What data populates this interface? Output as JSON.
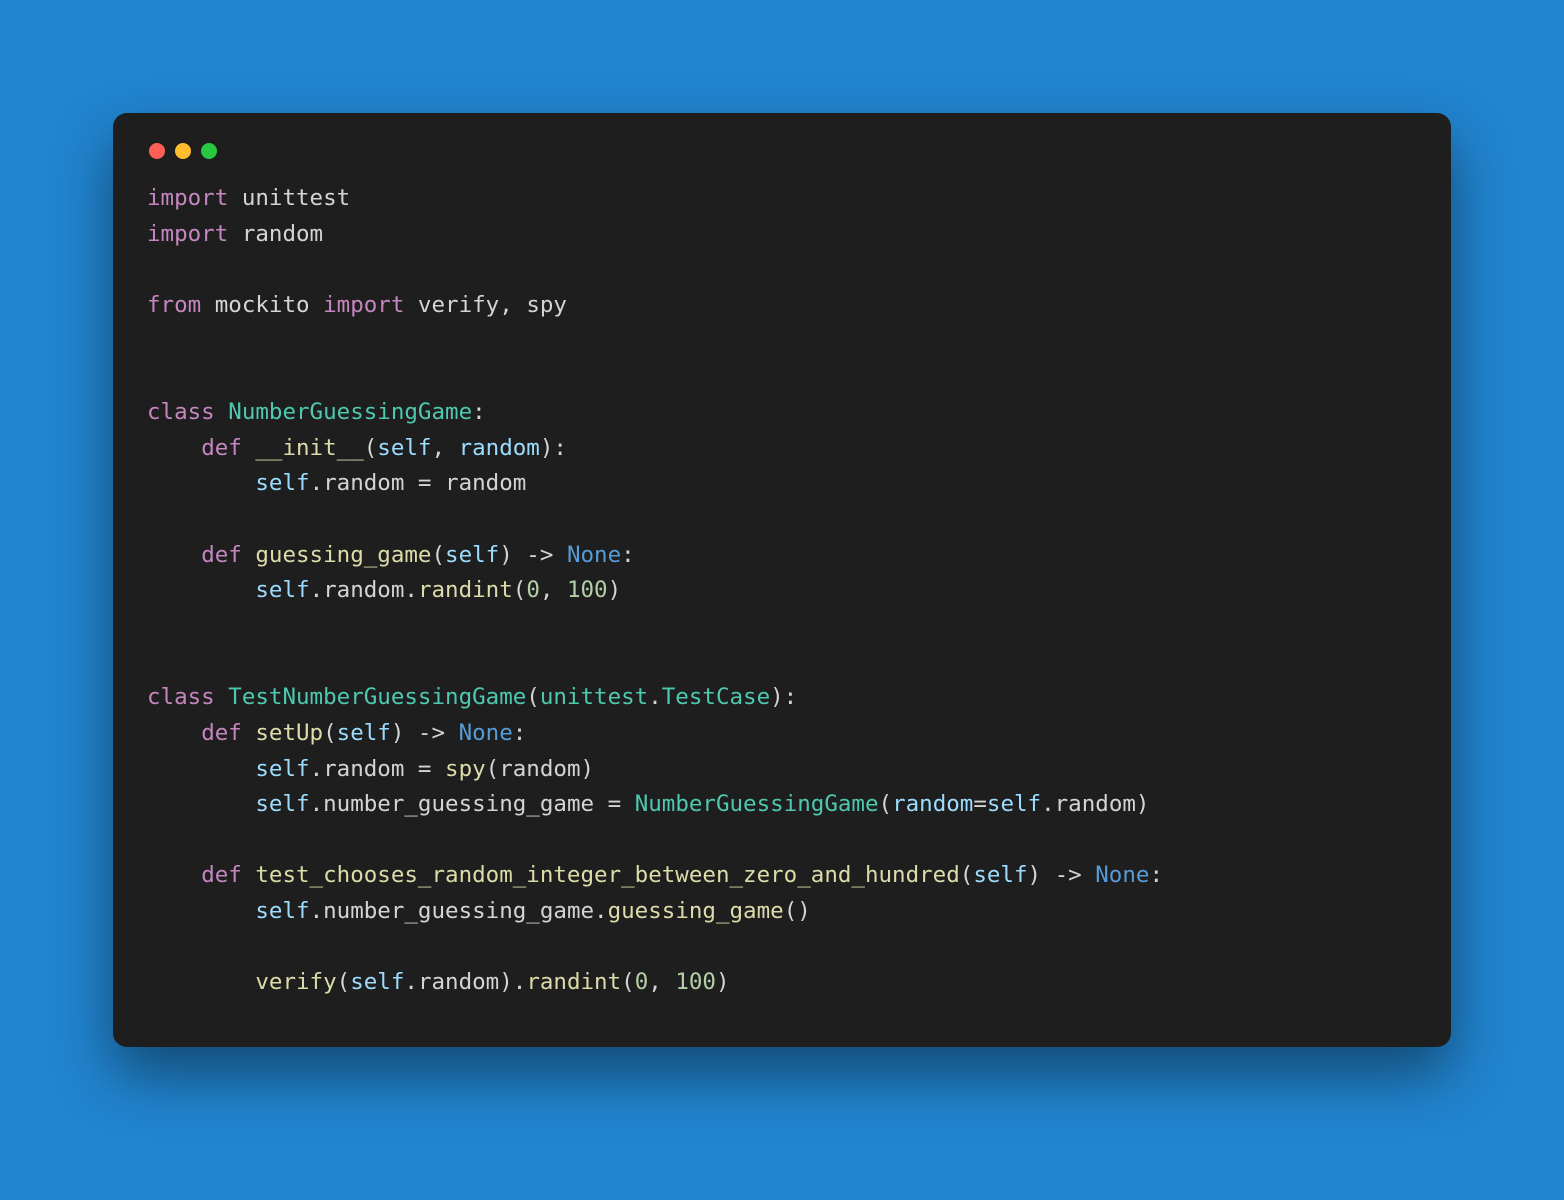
{
  "window": {
    "traffic_colors": {
      "red": "#ff5f57",
      "yellow": "#febc2e",
      "green": "#28c840"
    }
  },
  "theme": {
    "page_bg": "#2185d0",
    "editor_bg": "#1e1e1e",
    "fg": "#d4d4d4",
    "keyword": "#c586c0",
    "classname": "#4ec9b0",
    "function": "#dcdcaa",
    "selfparam": "#9cdcfe",
    "number": "#b5cea8",
    "builtin_const": "#569cd6"
  },
  "code": {
    "language": "python",
    "tokens": [
      [
        [
          "kw",
          "import"
        ],
        [
          "id",
          " unittest"
        ]
      ],
      [
        [
          "kw",
          "import"
        ],
        [
          "id",
          " random"
        ]
      ],
      [],
      [
        [
          "kw",
          "from"
        ],
        [
          "id",
          " mockito "
        ],
        [
          "kw",
          "import"
        ],
        [
          "id",
          " verify"
        ],
        [
          "pun",
          ", "
        ],
        [
          "id",
          "spy"
        ]
      ],
      [],
      [],
      [
        [
          "kw",
          "class"
        ],
        [
          "id",
          " "
        ],
        [
          "cls",
          "NumberGuessingGame"
        ],
        [
          "pun",
          ":"
        ]
      ],
      [
        [
          "id",
          "    "
        ],
        [
          "kw",
          "def"
        ],
        [
          "id",
          " "
        ],
        [
          "fn",
          "__init__"
        ],
        [
          "pun",
          "("
        ],
        [
          "self",
          "self"
        ],
        [
          "pun",
          ", "
        ],
        [
          "self",
          "random"
        ],
        [
          "pun",
          "):"
        ]
      ],
      [
        [
          "id",
          "        "
        ],
        [
          "self",
          "self"
        ],
        [
          "pun",
          "."
        ],
        [
          "id",
          "random"
        ],
        [
          "pun",
          " = "
        ],
        [
          "id",
          "random"
        ]
      ],
      [],
      [
        [
          "id",
          "    "
        ],
        [
          "kw",
          "def"
        ],
        [
          "id",
          " "
        ],
        [
          "fn",
          "guessing_game"
        ],
        [
          "pun",
          "("
        ],
        [
          "self",
          "self"
        ],
        [
          "pun",
          ") -> "
        ],
        [
          "none",
          "None"
        ],
        [
          "pun",
          ":"
        ]
      ],
      [
        [
          "id",
          "        "
        ],
        [
          "self",
          "self"
        ],
        [
          "pun",
          "."
        ],
        [
          "id",
          "random"
        ],
        [
          "pun",
          "."
        ],
        [
          "fn",
          "randint"
        ],
        [
          "pun",
          "("
        ],
        [
          "num",
          "0"
        ],
        [
          "pun",
          ", "
        ],
        [
          "num",
          "100"
        ],
        [
          "pun",
          ")"
        ]
      ],
      [],
      [],
      [
        [
          "kw",
          "class"
        ],
        [
          "id",
          " "
        ],
        [
          "cls",
          "TestNumberGuessingGame"
        ],
        [
          "pun",
          "("
        ],
        [
          "cls",
          "unittest"
        ],
        [
          "pun",
          "."
        ],
        [
          "cls",
          "TestCase"
        ],
        [
          "pun",
          "):"
        ]
      ],
      [
        [
          "id",
          "    "
        ],
        [
          "kw",
          "def"
        ],
        [
          "id",
          " "
        ],
        [
          "fn",
          "setUp"
        ],
        [
          "pun",
          "("
        ],
        [
          "self",
          "self"
        ],
        [
          "pun",
          ") -> "
        ],
        [
          "none",
          "None"
        ],
        [
          "pun",
          ":"
        ]
      ],
      [
        [
          "id",
          "        "
        ],
        [
          "self",
          "self"
        ],
        [
          "pun",
          "."
        ],
        [
          "id",
          "random"
        ],
        [
          "pun",
          " = "
        ],
        [
          "fn",
          "spy"
        ],
        [
          "pun",
          "("
        ],
        [
          "id",
          "random"
        ],
        [
          "pun",
          ")"
        ]
      ],
      [
        [
          "id",
          "        "
        ],
        [
          "self",
          "self"
        ],
        [
          "pun",
          "."
        ],
        [
          "id",
          "number_guessing_game"
        ],
        [
          "pun",
          " = "
        ],
        [
          "cls",
          "NumberGuessingGame"
        ],
        [
          "pun",
          "("
        ],
        [
          "self",
          "random"
        ],
        [
          "pun",
          "="
        ],
        [
          "self",
          "self"
        ],
        [
          "pun",
          "."
        ],
        [
          "id",
          "random"
        ],
        [
          "pun",
          ")"
        ]
      ],
      [],
      [
        [
          "id",
          "    "
        ],
        [
          "kw",
          "def"
        ],
        [
          "id",
          " "
        ],
        [
          "fn",
          "test_chooses_random_integer_between_zero_and_hundred"
        ],
        [
          "pun",
          "("
        ],
        [
          "self",
          "self"
        ],
        [
          "pun",
          ") -> "
        ],
        [
          "none",
          "None"
        ],
        [
          "pun",
          ":"
        ]
      ],
      [
        [
          "id",
          "        "
        ],
        [
          "self",
          "self"
        ],
        [
          "pun",
          "."
        ],
        [
          "id",
          "number_guessing_game"
        ],
        [
          "pun",
          "."
        ],
        [
          "fn",
          "guessing_game"
        ],
        [
          "pun",
          "()"
        ]
      ],
      [],
      [
        [
          "id",
          "        "
        ],
        [
          "fn",
          "verify"
        ],
        [
          "pun",
          "("
        ],
        [
          "self",
          "self"
        ],
        [
          "pun",
          "."
        ],
        [
          "id",
          "random"
        ],
        [
          "pun",
          ")."
        ],
        [
          "fn",
          "randint"
        ],
        [
          "pun",
          "("
        ],
        [
          "num",
          "0"
        ],
        [
          "pun",
          ", "
        ],
        [
          "num",
          "100"
        ],
        [
          "pun",
          ")"
        ]
      ]
    ],
    "plain_text": "import unittest\nimport random\n\nfrom mockito import verify, spy\n\n\nclass NumberGuessingGame:\n    def __init__(self, random):\n        self.random = random\n\n    def guessing_game(self) -> None:\n        self.random.randint(0, 100)\n\n\nclass TestNumberGuessingGame(unittest.TestCase):\n    def setUp(self) -> None:\n        self.random = spy(random)\n        self.number_guessing_game = NumberGuessingGame(random=self.random)\n\n    def test_chooses_random_integer_between_zero_and_hundred(self) -> None:\n        self.number_guessing_game.guessing_game()\n\n        verify(self.random).randint(0, 100)"
  }
}
